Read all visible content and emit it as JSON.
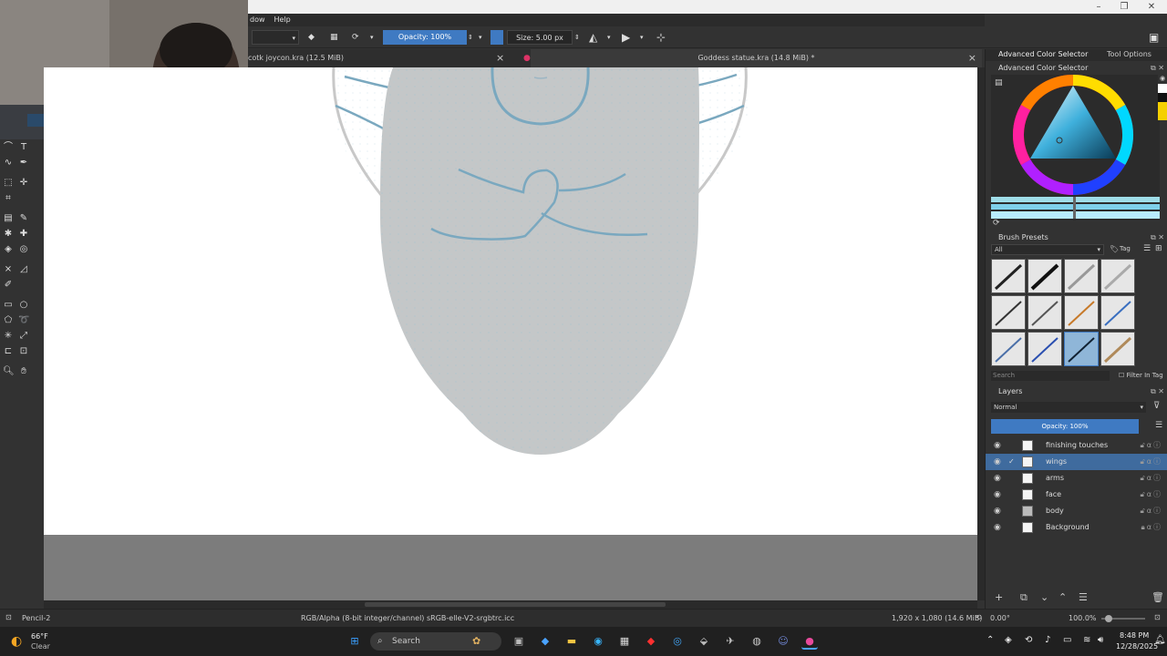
{
  "menu": {
    "items": [
      "dow",
      "Help"
    ]
  },
  "toolbar": {
    "opacity_label": "Opacity: 100%",
    "size_label": "Size: 5.00 px"
  },
  "tabs": [
    {
      "label": "cotk joycon.kra (12.5 MiB)",
      "close": "×"
    },
    {
      "label": "Goddess statue.kra (14.8 MiB) *",
      "close": "×"
    }
  ],
  "color_selector": {
    "header_left": "Advanced Color Selector",
    "header_right": "Tool Options",
    "panel_title": "Advanced Color Selector"
  },
  "brush_presets": {
    "title": "Brush Presets",
    "filter_value": "All",
    "tag_label": "Tag",
    "search_placeholder": "Search",
    "filter_in_tag": "Filter In Tag"
  },
  "layers": {
    "title": "Layers",
    "blend_mode": "Normal",
    "opacity_label": "Opacity:  100%",
    "items": [
      {
        "name": "finishing touches",
        "selected": false,
        "locked": false
      },
      {
        "name": "wings",
        "selected": true,
        "locked": false
      },
      {
        "name": "arms",
        "selected": false,
        "locked": false
      },
      {
        "name": "face",
        "selected": false,
        "locked": false
      },
      {
        "name": "body",
        "selected": false,
        "locked": false
      },
      {
        "name": "Background",
        "selected": false,
        "locked": true
      }
    ]
  },
  "status": {
    "brush_name": "Pencil-2",
    "color_space": "RGB/Alpha (8-bit integer/channel)  sRGB-elle-V2-srgbtrc.icc",
    "dimensions": "1,920 x 1,080 (14.6 MiB)",
    "rotation": "0.00°",
    "zoom": "100.0%"
  },
  "taskbar": {
    "weather_temp": "66°F",
    "weather_desc": "Clear",
    "search_placeholder": "Search",
    "time": "8:48 PM",
    "date": "12/28/2025"
  },
  "colors": {
    "accent": "#3f7ac2",
    "canvas_bg": "#ffffff",
    "figure_gray": "#c4c7c8",
    "line_blue": "#7aa8bf"
  }
}
